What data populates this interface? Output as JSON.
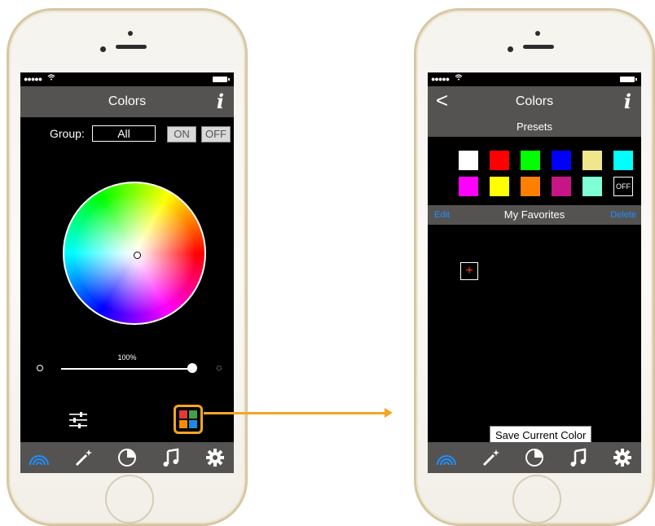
{
  "left_screen": {
    "nav_title": "Colors",
    "info_label": "i",
    "group_label": "Group:",
    "group_value": "All",
    "on_label": "ON",
    "off_label": "OFF",
    "brightness_percent": "100%",
    "brightness_value": 1.0
  },
  "right_screen": {
    "back_label": "<",
    "nav_title": "Colors",
    "info_label": "i",
    "presets_title": "Presets",
    "preset_colors": [
      "#ffffff",
      "#ff0000",
      "#00ff00",
      "#0000ff",
      "#f0e68c",
      "#00ffff",
      "#ff00ff",
      "#ffff00",
      "#ff7f00",
      "#c71585",
      "#7fffd4"
    ],
    "preset_off_label": "OFF",
    "favorites_title": "My Favorites",
    "edit_label": "Edit",
    "delete_label": "Delete",
    "add_label": "+",
    "save_label": "Save Current Color"
  },
  "tabs": [
    "rainbow-icon",
    "magic-wand-icon",
    "timer-icon",
    "music-note-icon",
    "gear-icon"
  ],
  "colors": {
    "highlight": "#f5a623",
    "nav_bg": "#555351",
    "active_tab": "#1e90ff",
    "link_blue": "#1e90ff"
  }
}
